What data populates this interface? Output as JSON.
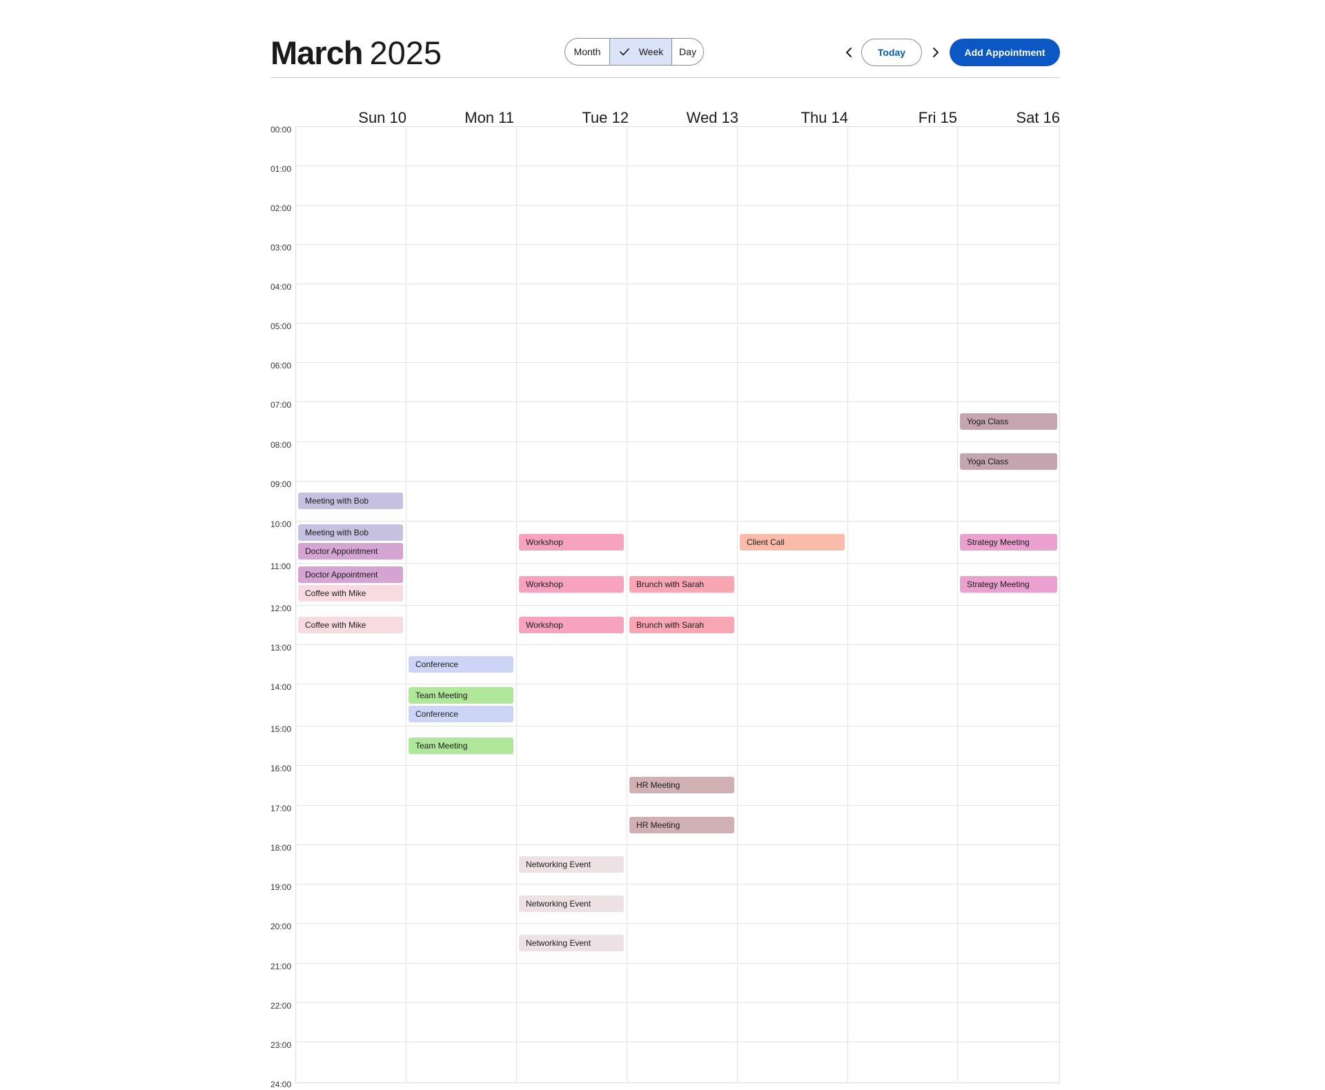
{
  "header": {
    "month": "March",
    "year": "2025",
    "views": [
      "Month",
      "Week",
      "Day"
    ],
    "active_view": "Week",
    "today_label": "Today",
    "add_label": "Add Appointment",
    "prev_icon": "chevron-left-icon",
    "next_icon": "chevron-right-icon",
    "check_icon": "check-icon"
  },
  "colors": {
    "primary": "#0b57c4",
    "today_text": "#0b57b8",
    "active_view_bg": "#dbe3f9"
  },
  "days": [
    "Sun 10",
    "Mon 11",
    "Tue 12",
    "Wed 13",
    "Thu 14",
    "Fri 15",
    "Sat 16"
  ],
  "times": [
    "00:00",
    "01:00",
    "02:00",
    "03:00",
    "04:00",
    "05:00",
    "06:00",
    "07:00",
    "08:00",
    "09:00",
    "10:00",
    "11:00",
    "12:00",
    "13:00",
    "14:00",
    "15:00",
    "16:00",
    "17:00",
    "18:00",
    "19:00",
    "20:00",
    "21:00",
    "22:00",
    "23:00",
    "24:00"
  ],
  "events": [
    {
      "title": "Meeting with Bob",
      "day": 0,
      "slot": "09:00",
      "color": "#c6c1e0"
    },
    {
      "title": "Meeting with Bob",
      "day": 0,
      "slot": "10:00",
      "color": "#c6c1e0"
    },
    {
      "title": "Doctor Appointment",
      "day": 0,
      "slot": "10:00",
      "color": "#d4a5d2"
    },
    {
      "title": "Doctor Appointment",
      "day": 0,
      "slot": "11:00",
      "color": "#d4a5d2"
    },
    {
      "title": "Coffee with Mike",
      "day": 0,
      "slot": "11:00",
      "color": "#f8dbe1"
    },
    {
      "title": "Coffee with Mike",
      "day": 0,
      "slot": "12:00",
      "color": "#f8dbe1"
    },
    {
      "title": "Conference",
      "day": 1,
      "slot": "13:00",
      "color": "#ccd5f6"
    },
    {
      "title": "Team Meeting",
      "day": 1,
      "slot": "14:00",
      "color": "#b0e79b"
    },
    {
      "title": "Conference",
      "day": 1,
      "slot": "14:00",
      "color": "#ccd5f6"
    },
    {
      "title": "Team Meeting",
      "day": 1,
      "slot": "15:00",
      "color": "#b0e79b"
    },
    {
      "title": "Workshop",
      "day": 2,
      "slot": "10:00",
      "color": "#f7a3bf"
    },
    {
      "title": "Workshop",
      "day": 2,
      "slot": "11:00",
      "color": "#f7a3bf"
    },
    {
      "title": "Workshop",
      "day": 2,
      "slot": "12:00",
      "color": "#f7a3bf"
    },
    {
      "title": "Networking Event",
      "day": 2,
      "slot": "18:00",
      "color": "#ede1e4"
    },
    {
      "title": "Networking Event",
      "day": 2,
      "slot": "19:00",
      "color": "#ede1e4"
    },
    {
      "title": "Networking Event",
      "day": 2,
      "slot": "20:00",
      "color": "#ede1e4"
    },
    {
      "title": "Brunch with Sarah",
      "day": 3,
      "slot": "11:00",
      "color": "#f8a5b4"
    },
    {
      "title": "Brunch with Sarah",
      "day": 3,
      "slot": "12:00",
      "color": "#f8a5b4"
    },
    {
      "title": "HR Meeting",
      "day": 3,
      "slot": "16:00",
      "color": "#d1b0b4"
    },
    {
      "title": "HR Meeting",
      "day": 3,
      "slot": "17:00",
      "color": "#d1b0b4"
    },
    {
      "title": "Client Call",
      "day": 4,
      "slot": "10:00",
      "color": "#f9bcaa"
    },
    {
      "title": "Yoga Class",
      "day": 6,
      "slot": "07:00",
      "color": "#c4a5b0"
    },
    {
      "title": "Yoga Class",
      "day": 6,
      "slot": "08:00",
      "color": "#c4a5b0"
    },
    {
      "title": "Strategy Meeting",
      "day": 6,
      "slot": "10:00",
      "color": "#eba1cf"
    },
    {
      "title": "Strategy Meeting",
      "day": 6,
      "slot": "11:00",
      "color": "#eba1cf"
    }
  ]
}
